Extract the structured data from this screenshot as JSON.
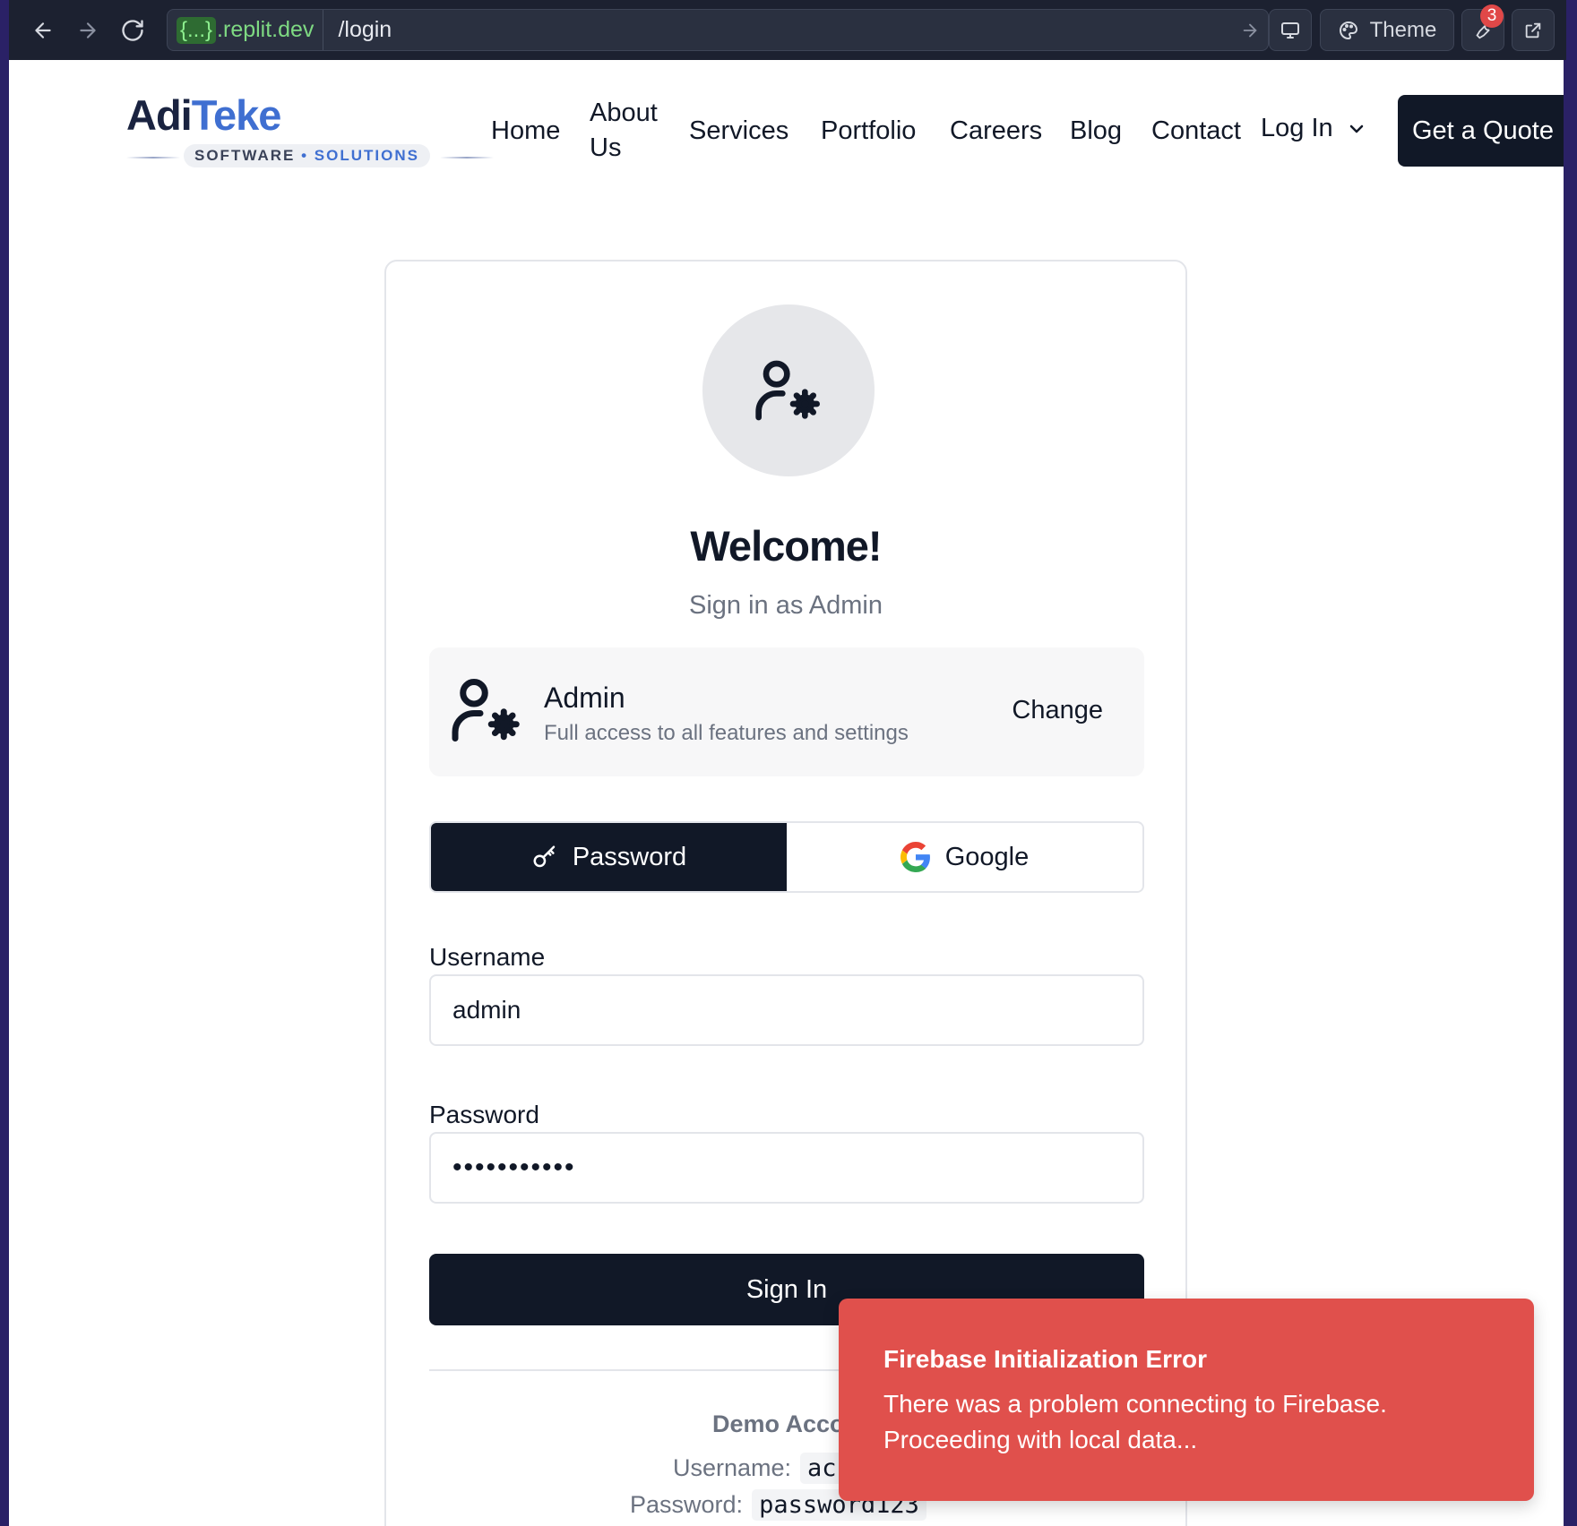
{
  "browser": {
    "url_host_badge": "{...}",
    "url_host": ".replit.dev",
    "url_path": "/login",
    "theme_label": "Theme",
    "notification_count": "3"
  },
  "header": {
    "logo_part1": "Adi",
    "logo_part2": "Teke",
    "logo_sub1": "SOFTWARE",
    "logo_dot": "•",
    "logo_sub2": "SOLUTIONS",
    "nav": {
      "home": "Home",
      "about_line1": "About",
      "about_line2": "Us",
      "services": "Services",
      "portfolio": "Portfolio",
      "careers": "Careers",
      "blog": "Blog",
      "contact": "Contact",
      "login": "Log In"
    },
    "quote_button": "Get a Quote"
  },
  "login_card": {
    "title": "Welcome!",
    "subtitle": "Sign in as Admin",
    "role": {
      "name": "Admin",
      "description": "Full access to all features and settings",
      "change_label": "Change"
    },
    "tabs": {
      "password": "Password",
      "google": "Google",
      "active": "password"
    },
    "username_label": "Username",
    "username_value": "admin",
    "password_label": "Password",
    "password_value": "•••••••••••",
    "signin_button": "Sign In",
    "demo": {
      "title": "Demo Accou",
      "username_label": "Username:",
      "username_value": "ac",
      "password_label": "Password:",
      "password_value": "password123"
    }
  },
  "toast": {
    "title": "Firebase Initialization Error",
    "message": "There was a problem connecting to Firebase. Proceeding with local data..."
  },
  "colors": {
    "primary": "#111827",
    "brand_blue": "#3f6fd1",
    "toast_bg": "#e0504c",
    "frame": "#2a2166"
  }
}
